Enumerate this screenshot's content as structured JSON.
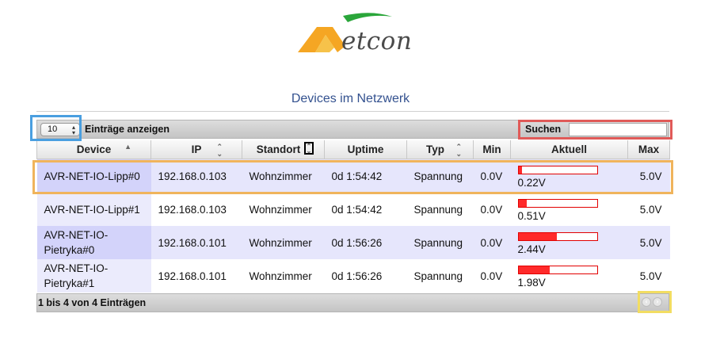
{
  "logo": {
    "text": "etcon"
  },
  "page_title": "Devices im Netzwerk",
  "length": {
    "value": "10",
    "label": "Einträge anzeigen"
  },
  "search": {
    "label": "Suchen",
    "value": ""
  },
  "columns": [
    "Device",
    "IP",
    "Standort",
    "Uptime",
    "Typ",
    "Min",
    "Aktuell",
    "Max"
  ],
  "rows": [
    {
      "device": "AVR-NET-IO-Lipp#0",
      "ip": "192.168.0.103",
      "standort": "Wohnzimmer",
      "uptime": "0d 1:54:42",
      "typ": "Spannung",
      "min": "0.0V",
      "aktuell": "0.22V",
      "aktuell_fraction": 0.044,
      "max": "5.0V"
    },
    {
      "device": "AVR-NET-IO-Lipp#1",
      "ip": "192.168.0.103",
      "standort": "Wohnzimmer",
      "uptime": "0d 1:54:42",
      "typ": "Spannung",
      "min": "0.0V",
      "aktuell": "0.51V",
      "aktuell_fraction": 0.102,
      "max": "5.0V"
    },
    {
      "device": "AVR-NET-IO-Pietryka#0",
      "ip": "192.168.0.101",
      "standort": "Wohnzimmer",
      "uptime": "0d 1:56:26",
      "typ": "Spannung",
      "min": "0.0V",
      "aktuell": "2.44V",
      "aktuell_fraction": 0.488,
      "max": "5.0V"
    },
    {
      "device": "AVR-NET-IO-Pietryka#1",
      "ip": "192.168.0.101",
      "standort": "Wohnzimmer",
      "uptime": "0d 1:56:26",
      "typ": "Spannung",
      "min": "0.0V",
      "aktuell": "1.98V",
      "aktuell_fraction": 0.396,
      "max": "5.0V"
    }
  ],
  "info": "1 bis 4 von 4 Einträgen",
  "colors": {
    "accent": "#33518f",
    "bar": "#ff2a2a",
    "bar_border": "#e20000",
    "highlight_blue": "#4a9fe0",
    "highlight_red": "#e05a58",
    "highlight_orange": "#f0b45c",
    "highlight_yellow": "#f2dd62"
  },
  "icons": {
    "sort_asc": "sort-asc-icon",
    "sort_both": "sort-both-icon",
    "prev": "prev-page-icon",
    "next": "next-page-icon"
  }
}
